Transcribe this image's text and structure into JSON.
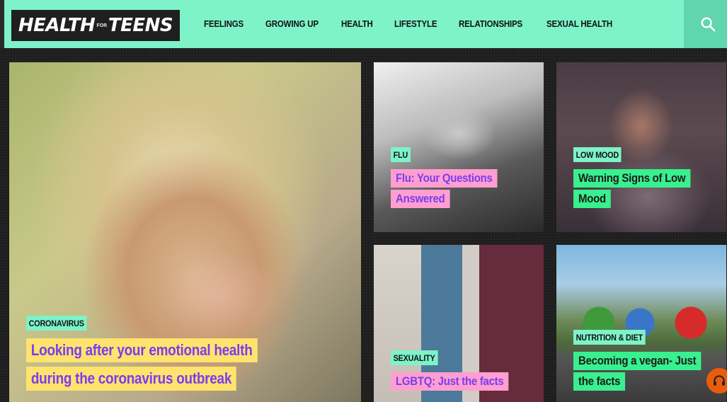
{
  "header": {
    "logo": {
      "left": "HEALTH",
      "small": "FOR",
      "right": "TEENS"
    },
    "nav": [
      "FEELINGS",
      "GROWING UP",
      "HEALTH",
      "LIFESTYLE",
      "RELATIONSHIPS",
      "SEXUAL HEALTH"
    ],
    "search_icon": "search-icon"
  },
  "cards": {
    "main": {
      "tag": "CORONAVIRUS",
      "lines": [
        "Looking after your emotional health",
        "during the coronavirus outbreak"
      ]
    },
    "flu": {
      "tag": "FLU",
      "lines": [
        "Flu: Your Questions",
        "Answered"
      ]
    },
    "mood": {
      "tag": "LOW MOOD",
      "lines": [
        "Warning Signs of Low",
        "Mood"
      ]
    },
    "lgbt": {
      "tag": "SEXUALITY",
      "lines": [
        "LGBTQ: Just the facts"
      ]
    },
    "vegan": {
      "tag": "NUTRITION & DIET",
      "lines": [
        "Becoming a vegan- Just",
        "the facts"
      ]
    }
  },
  "help_icon": "headset-icon",
  "colors": {
    "accent": "#7ef2c9",
    "pink": "#ff9fd0",
    "green": "#38f08e",
    "yellow": "#ffe36c",
    "purple_text": "#7b3cf0"
  }
}
